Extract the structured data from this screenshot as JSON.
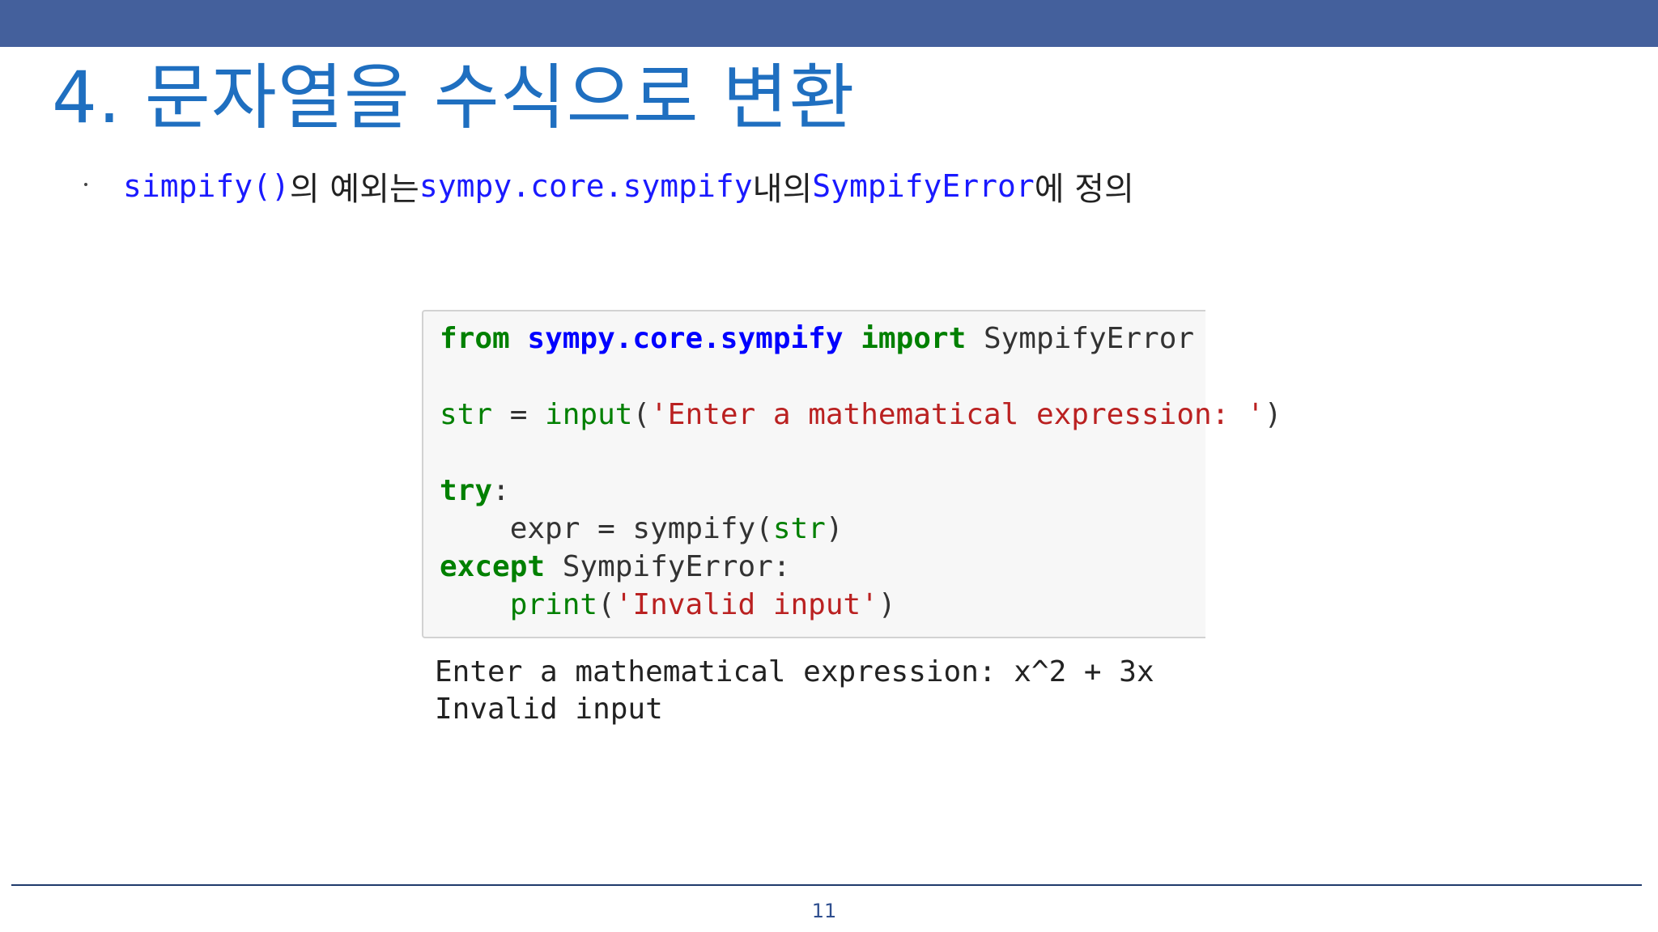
{
  "slide": {
    "title": "4. 문자열을 수식으로 변환",
    "page_number": "11"
  },
  "bullet": {
    "part1_code": "simpify()",
    "part2_text": "의 예외는 ",
    "part3_code": "sympy.core.sympify",
    "part4_text": " 내의 ",
    "part5_code": "SympifyError",
    "part6_text": "에 정의"
  },
  "code": {
    "line1": {
      "kw_from": "from",
      "module": "sympy.core.sympify",
      "kw_import": "import",
      "name": "SympifyError"
    },
    "line2": {
      "var": "str",
      "eq": " = ",
      "func": "input",
      "open": "(",
      "string": "'Enter a mathematical expression: '",
      "close": ")"
    },
    "line3": {
      "kw_try": "try",
      "colon": ":"
    },
    "line4": {
      "indent_assign": "    expr = sympify(",
      "arg": "str",
      "close": ")"
    },
    "line5": {
      "kw_except": "except",
      "rest": " SympifyError:"
    },
    "line6": {
      "indent": "    ",
      "func": "print",
      "open": "(",
      "string": "'Invalid input'",
      "close": ")"
    }
  },
  "output": {
    "line1": "Enter a mathematical expression: x^2 + 3x",
    "line2": "Invalid input"
  },
  "colors": {
    "header_bar": "#44609c",
    "title": "#1f6fc0",
    "inline_code": "#1a1aff",
    "keyword": "#008000",
    "module": "#0000ff",
    "string": "#ba2121"
  }
}
